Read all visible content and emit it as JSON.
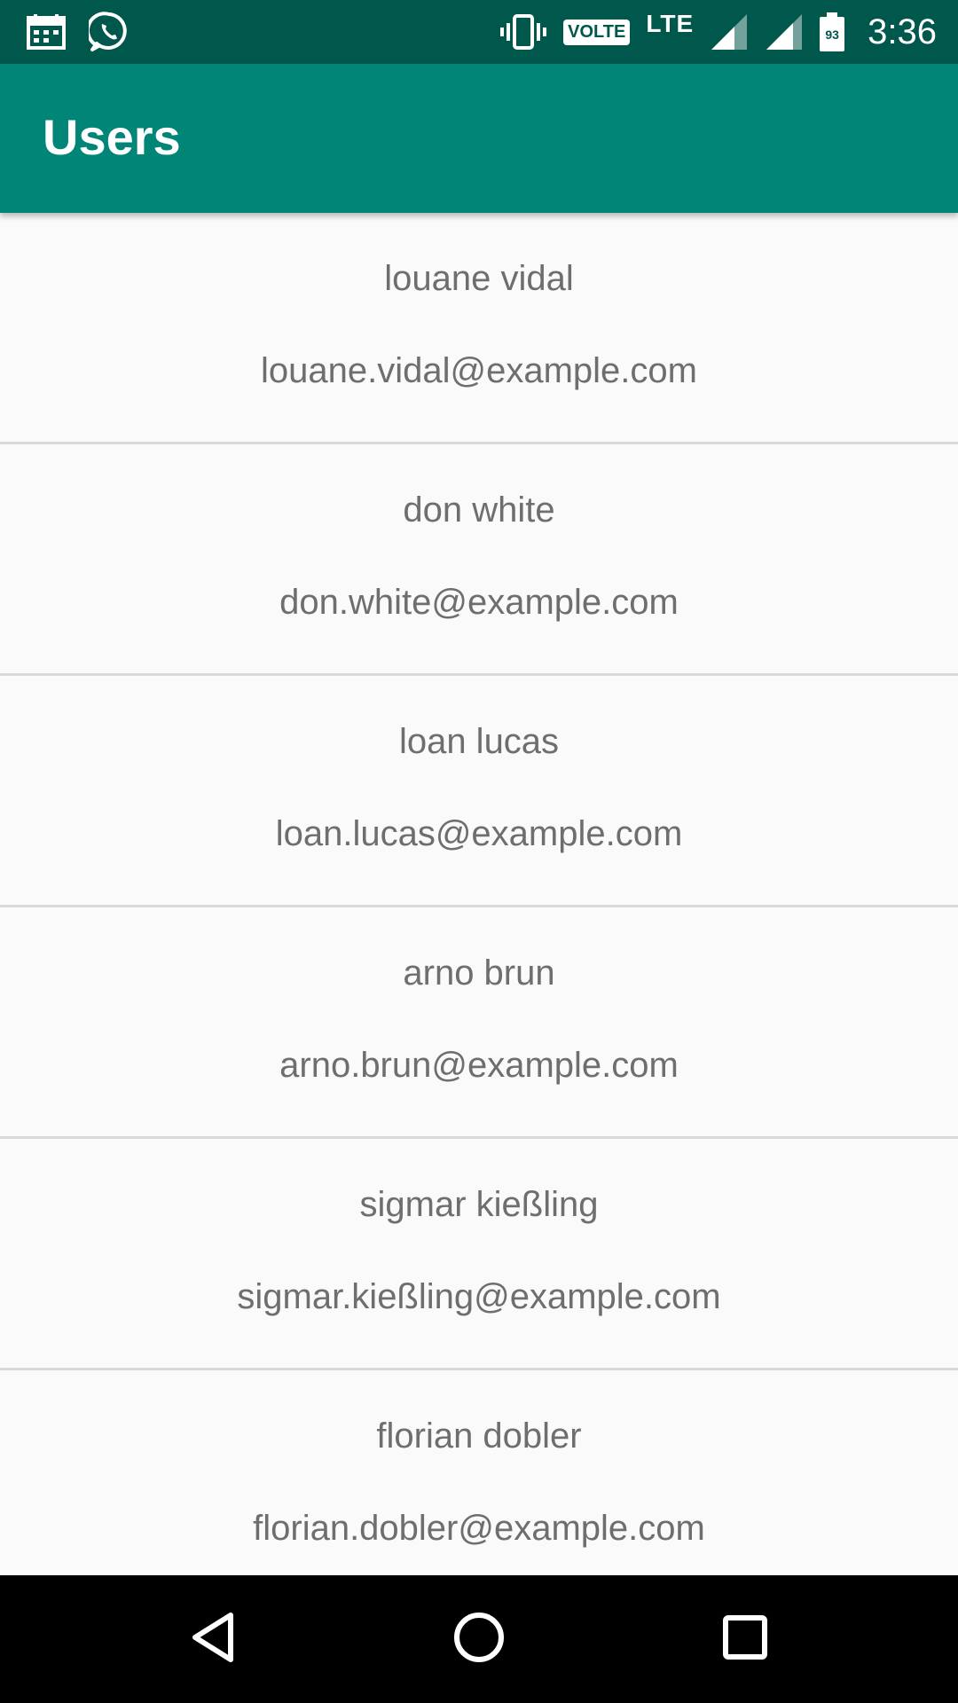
{
  "status_bar": {
    "network_label": "LTE",
    "volte_label": "VOLTE",
    "battery_level": "93",
    "time": "3:36",
    "icons": [
      "calendar-icon",
      "whatsapp-icon",
      "vibrate-icon",
      "signal-icon",
      "signal-icon",
      "battery-icon"
    ]
  },
  "app_bar": {
    "title": "Users"
  },
  "users": [
    {
      "name": "louane vidal",
      "email": "louane.vidal@example.com"
    },
    {
      "name": "don white",
      "email": "don.white@example.com"
    },
    {
      "name": "loan lucas",
      "email": "loan.lucas@example.com"
    },
    {
      "name": "arno brun",
      "email": "arno.brun@example.com"
    },
    {
      "name": "sigmar kießling",
      "email": "sigmar.kießling@example.com"
    },
    {
      "name": "florian dobler",
      "email": "florian.dobler@example.com"
    }
  ],
  "nav_bar": {
    "icons": [
      "back-icon",
      "home-icon",
      "recents-icon"
    ]
  },
  "colors": {
    "status_bar": "#00574b",
    "app_bar": "#008577",
    "list_background": "#fafafa",
    "text": "#6e6e6e",
    "divider": "#d9d9d9",
    "nav_bar": "#000000"
  }
}
